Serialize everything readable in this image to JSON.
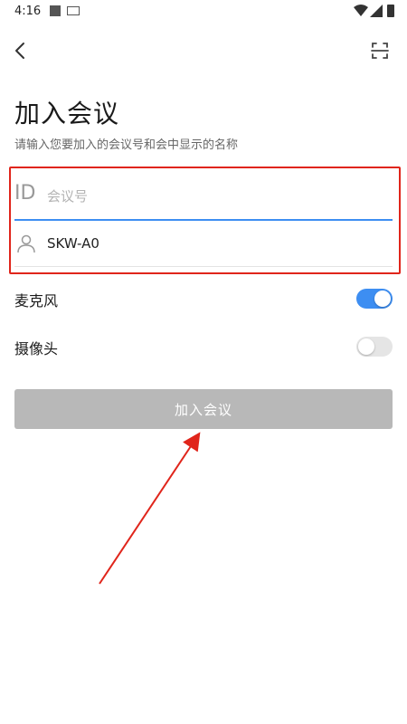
{
  "status_bar": {
    "time": "4:16"
  },
  "header": {
    "back_icon": "chevron-left-icon",
    "scan_icon": "scan-icon"
  },
  "title": "加入会议",
  "subtitle": "请输入您要加入的会议号和会中显示的名称",
  "form": {
    "meeting_id": {
      "icon_text": "ID",
      "placeholder": "会议号",
      "value": ""
    },
    "display_name": {
      "icon": "user-icon",
      "value": "SKW-A0"
    }
  },
  "toggles": {
    "microphone": {
      "label": "麦克风",
      "on": true
    },
    "camera": {
      "label": "摄像头",
      "on": false
    }
  },
  "join_button": {
    "label": "加入会议"
  },
  "colors": {
    "accent": "#3d8ef2",
    "highlight": "#e0251b",
    "disabled_button": "#b8b8b8"
  }
}
